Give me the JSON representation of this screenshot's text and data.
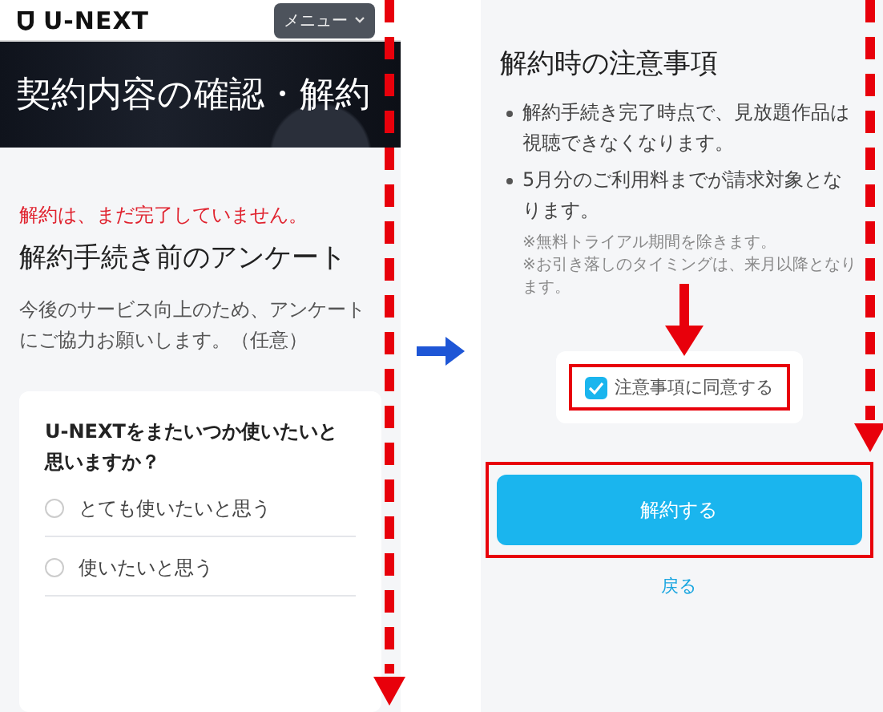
{
  "left_screen": {
    "logo": "U-NEXT",
    "menu_button": "メニュー",
    "hero_title": "契約内容の確認・解約",
    "warning": "解約は、まだ完了していません。",
    "heading": "解約手続き前のアンケート",
    "description": "今後のサービス向上のため、アンケートにご協力お願いします。（任意）",
    "survey": {
      "question": "U-NEXTをまたいつか使いたいと思いますか？",
      "options": [
        {
          "label": "とても使いたいと思う",
          "selected": false
        },
        {
          "label": "使いたいと思う",
          "selected": false
        }
      ]
    }
  },
  "right_screen": {
    "heading": "解約時の注意事項",
    "notes": [
      "解約手続き完了時点で、見放題作品は視聴できなくなります。",
      "5月分のご利用料までが請求対象となります。"
    ],
    "footnotes": [
      "※無料トライアル期間を除きます。",
      "※お引き落しのタイミングは、来月以降となります。"
    ],
    "agree": {
      "label": "注意事項に同意する",
      "checked": true
    },
    "cancel_button": "解約する",
    "back_link": "戻る"
  }
}
